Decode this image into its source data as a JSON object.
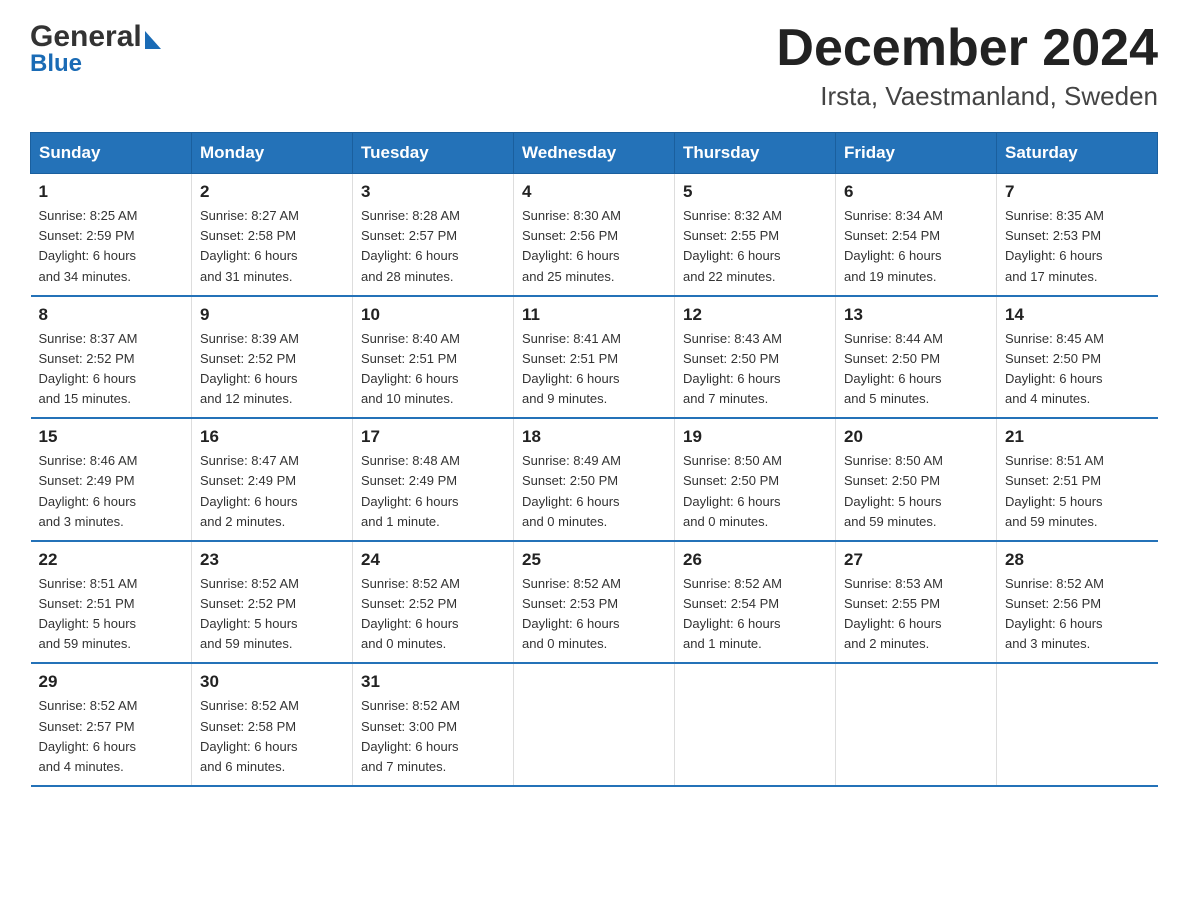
{
  "logo": {
    "general": "General",
    "blue": "Blue",
    "triangle": "▶"
  },
  "title": {
    "month_year": "December 2024",
    "location": "Irsta, Vaestmanland, Sweden"
  },
  "header_days": [
    "Sunday",
    "Monday",
    "Tuesday",
    "Wednesday",
    "Thursday",
    "Friday",
    "Saturday"
  ],
  "weeks": [
    [
      {
        "day": "1",
        "sunrise": "8:25 AM",
        "sunset": "2:59 PM",
        "daylight": "6 hours and 34 minutes."
      },
      {
        "day": "2",
        "sunrise": "8:27 AM",
        "sunset": "2:58 PM",
        "daylight": "6 hours and 31 minutes."
      },
      {
        "day": "3",
        "sunrise": "8:28 AM",
        "sunset": "2:57 PM",
        "daylight": "6 hours and 28 minutes."
      },
      {
        "day": "4",
        "sunrise": "8:30 AM",
        "sunset": "2:56 PM",
        "daylight": "6 hours and 25 minutes."
      },
      {
        "day": "5",
        "sunrise": "8:32 AM",
        "sunset": "2:55 PM",
        "daylight": "6 hours and 22 minutes."
      },
      {
        "day": "6",
        "sunrise": "8:34 AM",
        "sunset": "2:54 PM",
        "daylight": "6 hours and 19 minutes."
      },
      {
        "day": "7",
        "sunrise": "8:35 AM",
        "sunset": "2:53 PM",
        "daylight": "6 hours and 17 minutes."
      }
    ],
    [
      {
        "day": "8",
        "sunrise": "8:37 AM",
        "sunset": "2:52 PM",
        "daylight": "6 hours and 15 minutes."
      },
      {
        "day": "9",
        "sunrise": "8:39 AM",
        "sunset": "2:52 PM",
        "daylight": "6 hours and 12 minutes."
      },
      {
        "day": "10",
        "sunrise": "8:40 AM",
        "sunset": "2:51 PM",
        "daylight": "6 hours and 10 minutes."
      },
      {
        "day": "11",
        "sunrise": "8:41 AM",
        "sunset": "2:51 PM",
        "daylight": "6 hours and 9 minutes."
      },
      {
        "day": "12",
        "sunrise": "8:43 AM",
        "sunset": "2:50 PM",
        "daylight": "6 hours and 7 minutes."
      },
      {
        "day": "13",
        "sunrise": "8:44 AM",
        "sunset": "2:50 PM",
        "daylight": "6 hours and 5 minutes."
      },
      {
        "day": "14",
        "sunrise": "8:45 AM",
        "sunset": "2:50 PM",
        "daylight": "6 hours and 4 minutes."
      }
    ],
    [
      {
        "day": "15",
        "sunrise": "8:46 AM",
        "sunset": "2:49 PM",
        "daylight": "6 hours and 3 minutes."
      },
      {
        "day": "16",
        "sunrise": "8:47 AM",
        "sunset": "2:49 PM",
        "daylight": "6 hours and 2 minutes."
      },
      {
        "day": "17",
        "sunrise": "8:48 AM",
        "sunset": "2:49 PM",
        "daylight": "6 hours and 1 minute."
      },
      {
        "day": "18",
        "sunrise": "8:49 AM",
        "sunset": "2:50 PM",
        "daylight": "6 hours and 0 minutes."
      },
      {
        "day": "19",
        "sunrise": "8:50 AM",
        "sunset": "2:50 PM",
        "daylight": "6 hours and 0 minutes."
      },
      {
        "day": "20",
        "sunrise": "8:50 AM",
        "sunset": "2:50 PM",
        "daylight": "5 hours and 59 minutes."
      },
      {
        "day": "21",
        "sunrise": "8:51 AM",
        "sunset": "2:51 PM",
        "daylight": "5 hours and 59 minutes."
      }
    ],
    [
      {
        "day": "22",
        "sunrise": "8:51 AM",
        "sunset": "2:51 PM",
        "daylight": "5 hours and 59 minutes."
      },
      {
        "day": "23",
        "sunrise": "8:52 AM",
        "sunset": "2:52 PM",
        "daylight": "5 hours and 59 minutes."
      },
      {
        "day": "24",
        "sunrise": "8:52 AM",
        "sunset": "2:52 PM",
        "daylight": "6 hours and 0 minutes."
      },
      {
        "day": "25",
        "sunrise": "8:52 AM",
        "sunset": "2:53 PM",
        "daylight": "6 hours and 0 minutes."
      },
      {
        "day": "26",
        "sunrise": "8:52 AM",
        "sunset": "2:54 PM",
        "daylight": "6 hours and 1 minute."
      },
      {
        "day": "27",
        "sunrise": "8:53 AM",
        "sunset": "2:55 PM",
        "daylight": "6 hours and 2 minutes."
      },
      {
        "day": "28",
        "sunrise": "8:52 AM",
        "sunset": "2:56 PM",
        "daylight": "6 hours and 3 minutes."
      }
    ],
    [
      {
        "day": "29",
        "sunrise": "8:52 AM",
        "sunset": "2:57 PM",
        "daylight": "6 hours and 4 minutes."
      },
      {
        "day": "30",
        "sunrise": "8:52 AM",
        "sunset": "2:58 PM",
        "daylight": "6 hours and 6 minutes."
      },
      {
        "day": "31",
        "sunrise": "8:52 AM",
        "sunset": "3:00 PM",
        "daylight": "6 hours and 7 minutes."
      },
      null,
      null,
      null,
      null
    ]
  ],
  "labels": {
    "sunrise": "Sunrise:",
    "sunset": "Sunset:",
    "daylight": "Daylight:"
  }
}
